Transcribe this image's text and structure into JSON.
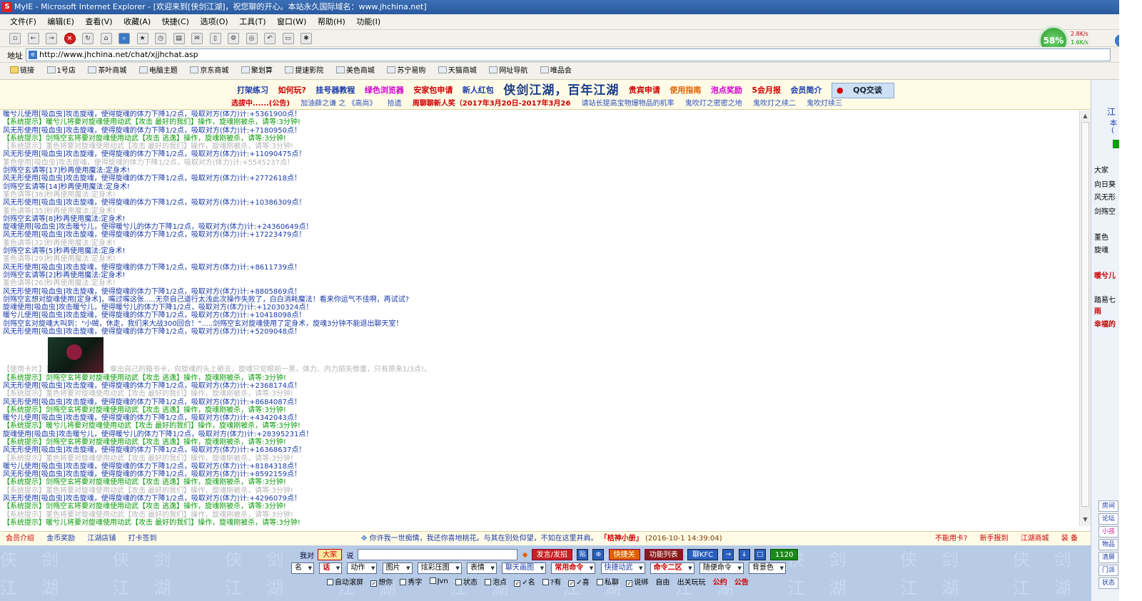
{
  "window": {
    "title": "MyIE - Microsoft Internet Explorer - [欢迎来到[侠剑江湖]，祝您聊的开心。本站永久国际域名：www.jhchina.net]"
  },
  "menu": [
    "文件(F)",
    "编辑(E)",
    "查看(V)",
    "收藏(A)",
    "快捷(C)",
    "选项(O)",
    "工具(T)",
    "窗口(W)",
    "帮助(H)",
    "功能(I)"
  ],
  "perf": {
    "cpu": "58%",
    "up": "2.8K/s",
    "down": "1.6K/s"
  },
  "address": {
    "label": "地址",
    "url": "http://www.jhchina.net/chat/xjjhchat.asp"
  },
  "favorites": [
    "链接",
    "1号店",
    "茶叶商城",
    "电脑主题",
    "京东商城",
    "聚划算",
    "提速影院",
    "美色商城",
    "苏宁易购",
    "天猫商城",
    "网址导航",
    "唯品会"
  ],
  "header": {
    "row1": [
      "打架练习",
      "如何玩?",
      "挂号器教程",
      "绿色浏览器",
      "安家包申请",
      "新人红包"
    ],
    "title": "侠剑江湖，百年江湖",
    "row1b": [
      "贵宾申请",
      "使用指南",
      "泡点奖励",
      "5会月报",
      "会员简介"
    ],
    "qq": "QQ交谈",
    "row2": [
      "选拔中......(公告)",
      "加油薛之谦 之 《高尚》",
      "拾遗",
      "周聊聊新人奖（2017年3月20日-2017年3月26",
      "请站长提高宝物爆物品的机率",
      "鬼吹灯之密密之地",
      "鬼吹灯之续二",
      "鬼吹灯续三"
    ]
  },
  "chat": {
    "lines": [
      "暖兮儿使用[吸血虫]攻击旋魂，使得旋魂的体力下降1/2点，吸取对方(体力)计:+5361900点！",
      "【系统提示】暖兮儿将要对旋魂使用动武【攻击 最好的我们】操作，旋魂刚被杀，请等:3分钟!",
      "风无形使用[吸血虫]攻击旋魂，使得旋魂的体力下降1/2点，吸取对方(体力)计:+7180950点！",
      "【系统提示】剑殇空玄将要对旋魂使用动武【攻击 逃逸】操作，旋魂刚被杀，请等:3分钟!",
      "【系统提示】堇色将要对旋魂使用动武【攻击 最好的我们】操作，旋魂刚被杀，请等:3分钟!",
      "风无形使用[吸血虫]攻击旋魂，使得旋魂的体力下降1/2点，吸取对方(体力)计:+11090475点！",
      "堇色使用[吸血虫]攻击旋魂，使得旋魂的体力下降1/2点，吸取对方(体力)计:+5545237点！",
      "剑殇空玄请等[17]秒再使用魔法:定身术!",
      "风无形使用[吸血虫]攻击旋魂，使得旋魂的体力下降1/2点，吸取对方(体力)计:+2772618点！",
      "剑殇空玄请等[14]秒再使用魔法:定身术!",
      "堇色请等[38]秒再使用魔法:定身术!",
      "风无形使用[吸血虫]攻击旋魂，使得旋魂的体力下降1/2点，吸取对方(体力)计:+10386309点！",
      "堇色请等[35]秒再使用魔法:定身术!",
      "剑殇空玄请等[8]秒再使用魔法:定身术!",
      "旋魂使用[吸血虫]攻击暖兮儿，使得暖兮儿的体力下降1/2点，吸取对方(体力)计:+24360649点！",
      "风无形使用[吸血虫]攻击旋魂，使得旋魂的体力下降1/2点，吸取对方(体力)计:+17223479点！",
      "堇色请等[32]秒再使用魔法:定身术!",
      "剑殇空玄请等[5]秒再使用魔法:定身术!",
      "堇色请等[29]秒再使用魔法:定身术!",
      "风无形使用[吸血虫]攻击旋魂，使得旋魂的体力下降1/2点，吸取对方(体力)计:+8611739点！",
      "剑殇空玄请等[2]秒再使用魔法:定身术!",
      "堇色请等[26]秒再使用魔法:定身术!",
      "风无形使用[吸血虫]攻击旋魂，使得旋魂的体力下降1/2点，吸取对方(体力)计:+8805869点！",
      "剑殇空玄想对旋魂使用[定身术]，嘴过嘴这张.....无奈自己道行太浅此次操作失败了，白白消耗魔法！看来你运气不佳啊，再试试?",
      "旋魂使用[吸血虫]攻击暖兮儿，使得暖兮儿的体力下降1/2点，吸取对方(体力)计:+12030324点！",
      "暖兮儿使用[吸血虫]攻击旋魂，使得旋魂的体力下降1/2点，吸取对方(体力)计:+10418098点！",
      "剑殇空玄对旋魂大叫到：\"小贼，休走，我们来大战300回合！\".....剑殇空玄对旋魂使用了定身术，旋魂3分钟不能退出聊天室！",
      "风无形使用[吸血虫]攻击旋魂，使得旋魂的体力下降1/2点，吸取对方(体力)计:+5209048点！"
    ],
    "card_line": "【使用卡片】堇色终于忍无可忍，拿出自己的箱书卡，向旋魂的头上砸去，旋魂只觉眼前一黑，体力、内力损失惨重，只有原来1/3点!。",
    "lines2": [
      "【系统提示】剑殇空玄将要对旋魂使用动武【攻击 逃逸】操作，旋魂刚被杀，请等:3分钟!",
      "风无形使用[吸血虫]攻击旋魂，使得旋魂的体力下降1/2点，吸取对方(体力)计:+2368174点！",
      "【系统提示】堇色将要对旋魂使用动武【攻击 最好的我们】操作，旋魂刚被杀，请等:3分钟!",
      "风无形使用[吸血虫]攻击旋魂，使得旋魂的体力下降1/2点，吸取对方(体力)计:+8684087点！",
      "【系统提示】剑殇空玄将要对旋魂使用动武【攻击 逃逸】操作，旋魂刚被杀，请等:3分钟!",
      "暖兮儿使用[吸血虫]攻击旋魂，使得旋魂的体力下降1/2点，吸取对方(体力)计:+4342043点！",
      "【系统提示】暖兮儿将要对旋魂使用动武【攻击 最好的我们】操作，旋魂刚被杀，请等:3分钟!",
      "旋魂使用[吸血虫]攻击暖兮儿，使得暖兮儿的体力下降1/2点，吸取对方(体力)计:+28395231点！",
      "【系统提示】剑殇空玄将要对旋魂使用动武【攻击 逃逸】操作，旋魂刚被杀，请等:3分钟!",
      "风无形使用[吸血虫]攻击旋魂，使得旋魂的体力下降1/2点，吸取对方(体力)计:+16368637点！",
      "【系统提示】堇色将要对旋魂使用动武【攻击 最好的我们】操作，旋魂刚被杀，请等:3分钟!",
      "暖兮儿使用[吸血虫]攻击旋魂，使得旋魂的体力下降1/2点，吸取对方(体力)计:+8184318点！",
      "风无形使用[吸血虫]攻击旋魂，使得旋魂的体力下降1/2点，吸取对方(体力)计:+8592159点！",
      "【系统提示】剑殇空玄将要对旋魂使用动武【攻击 逃逸】操作，旋魂刚被杀，请等:3分钟!",
      "【系统提示】堇色将要对旋魂使用动武【攻击 最好的我们】操作，旋魂刚被杀，请等:3分钟!",
      "风无形使用[吸血虫]攻击旋魂，使得旋魂的体力下降1/2点，吸取对方(体力)计:+4296079点！",
      "【系统提示】剑殇空玄将要对旋魂使用动武【攻击 逃逸】操作，旋魂刚被杀，请等:3分钟!",
      "【系统提示】堇色将要对旋魂使用动武【攻击 最好的我们】操作，旋魂刚被杀，请等:3分钟!",
      "【系统提示】暖兮儿将要对旋魂使用动武【攻击 最好的我们】操作，旋魂刚被杀，请等:3分钟!"
    ]
  },
  "right_panel": {
    "top": "江",
    "top2": "本",
    "top3": "(",
    "heading": "大家",
    "users": [
      "向日葵",
      "风无形",
      "剑殇空",
      "堇色",
      "旋魂",
      "暖兮儿",
      "踏易七",
      "雨",
      "幸福的"
    ],
    "buttons": [
      "房间",
      "论坛",
      "小孩",
      "物品",
      "清屏",
      "门派",
      "状态"
    ]
  },
  "bottom": {
    "left": [
      "会员介绍",
      "金币奖励",
      "江湖店铺",
      "打卡签到"
    ],
    "marquee": "你许我一世痴情，我还你喜地桃花。与其在别处仰望，不如在这里并肩。",
    "marquee_user": "「桔神小册」",
    "marquee_time": "(2016-10-1 14:39:04)",
    "right": [
      "不能用卡?",
      "新手报到",
      "江湖商城",
      "装 备"
    ]
  },
  "controls": {
    "watermark": "侠剑 侠剑 侠剑 侠剑 侠剑 侠剑 侠剑 侠剑 侠剑 侠剑 侠剑 侠剑",
    "watermark2": "江湖 江湖 江湖 江湖 江湖 江湖 江湖 江湖 江湖 江湖 江湖 江湖",
    "to_label": "我对",
    "to_value": "大家",
    "say_label": "说",
    "send": "发言/发招",
    "b1": "贴",
    "b2": "⊕",
    "quick_close": "快捷关",
    "feature_list": "功能列表",
    "kfc": "聊KFC",
    "up": "→",
    "down": "↓",
    "stop": "□",
    "count": "1120",
    "dropdowns": [
      "名",
      "话",
      "动作",
      "图片",
      "炫彩压图",
      "表情",
      "聊天画图",
      "常用命令",
      "快捷动武",
      "命令二区",
      "随便命令",
      "背景色"
    ],
    "checks": [
      "自动滚屏",
      "想你",
      "秀字",
      "Jvn",
      "状态",
      "泡点",
      "✓名",
      "?有",
      "✓喜",
      "私聊",
      "说绑",
      "自由",
      "出关玩玩",
      "公约",
      "公告"
    ]
  }
}
